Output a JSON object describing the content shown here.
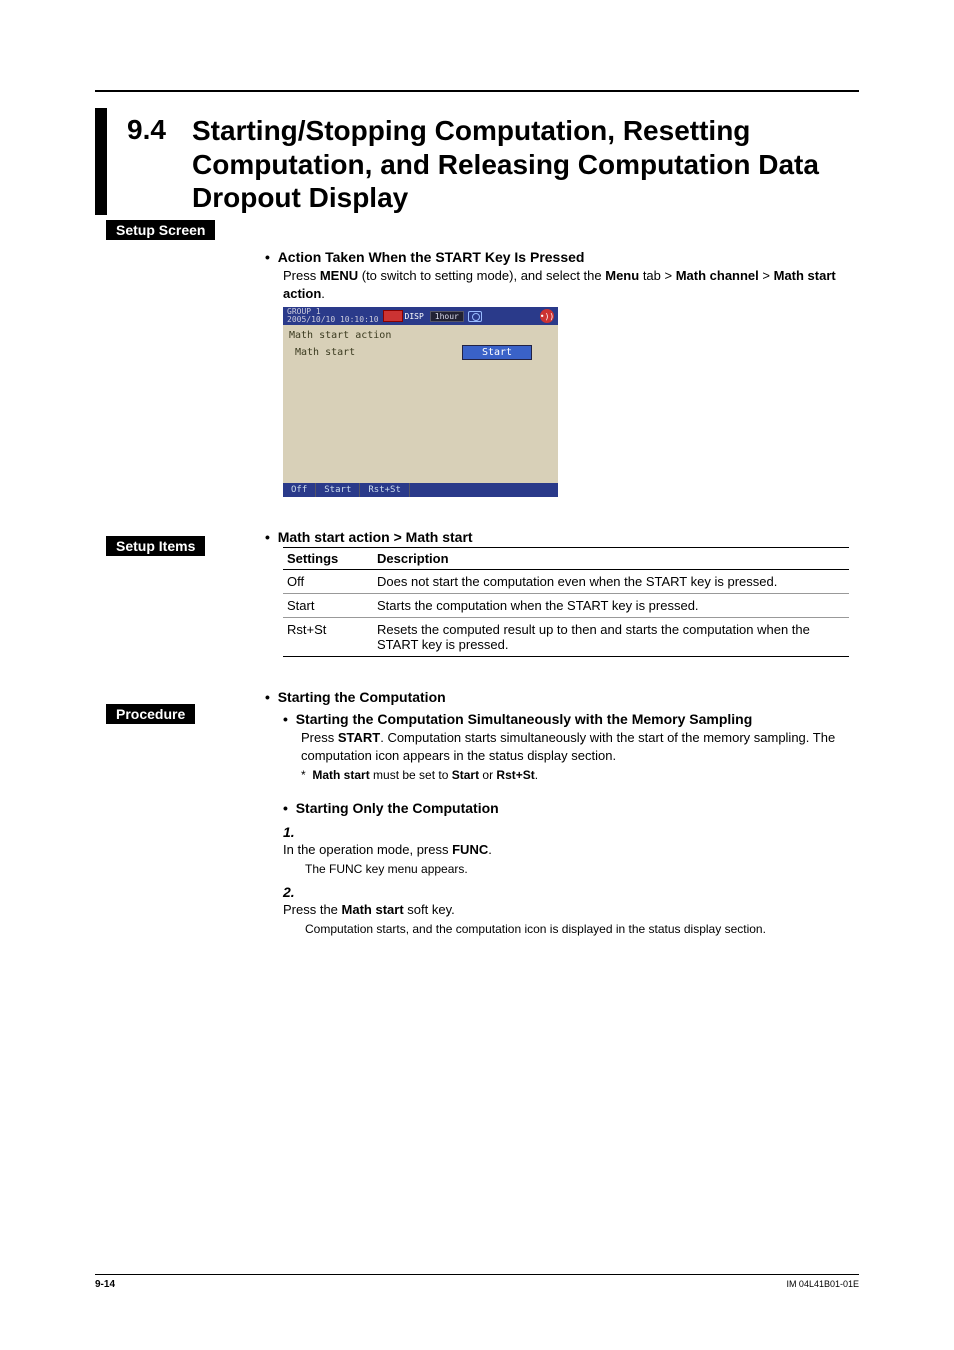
{
  "heading": {
    "number": "9.4",
    "title": "Starting/Stopping Computation, Resetting Computation, and Releasing Computation Data Dropout Display"
  },
  "setup_screen": {
    "label": "Setup Screen",
    "action_heading": "Action Taken When the START Key Is Pressed",
    "press_prefix": "Press ",
    "menu": "MENU",
    "press_mid": " (to switch to setting mode), and select the ",
    "menu_tab": "Menu",
    "tab_gt": " tab > ",
    "math_channel": "Math channel",
    "gt2": " > ",
    "math_start_action": "Math start action",
    "period": "."
  },
  "screenshot": {
    "group": "GROUP 1",
    "datetime": "2005/10/10 10:10:10",
    "disp": "DISP",
    "hour": "1hour",
    "title": "Math start action",
    "row_label": "Math start",
    "row_value": "Start",
    "btns": [
      "Off",
      "Start",
      "Rst+St"
    ]
  },
  "setup_items": {
    "label": "Setup Items",
    "heading": "Math start action > Math start",
    "col_settings": "Settings",
    "col_desc": "Description",
    "rows": [
      {
        "s": "Off",
        "d": "Does not start the computation even when the START key is pressed."
      },
      {
        "s": "Start",
        "d": "Starts the computation when the START key is pressed."
      },
      {
        "s": "Rst+St",
        "d": "Resets the computed result up to then and starts the computation when the START key is pressed."
      }
    ]
  },
  "procedure": {
    "label": "Procedure",
    "h1": "Starting the Computation",
    "h2": "Starting the Computation Simultaneously with the Memory Sampling",
    "p1a": "Press ",
    "p1_start": "START",
    "p1b": ". Computation starts simultaneously with the start of the memory sampling. The computation icon appears in the status display section.",
    "note_star": "*",
    "note_a": "Math start",
    "note_mid": " must be set to ",
    "note_b": "Start",
    "note_or": " or ",
    "note_c": "Rst+St",
    "note_end": ".",
    "h3": "Starting Only the Computation",
    "step1_a": "In the operation mode, press ",
    "step1_func": "FUNC",
    "step1_b": ".",
    "step1_sub": "The FUNC key menu appears.",
    "step2_a": "Press the ",
    "step2_b": "Math start",
    "step2_c": " soft key.",
    "step2_sub": "Computation starts, and the computation icon is displayed in the status display section."
  },
  "footer": {
    "page": "9-14",
    "doc": "IM 04L41B01-01E"
  }
}
